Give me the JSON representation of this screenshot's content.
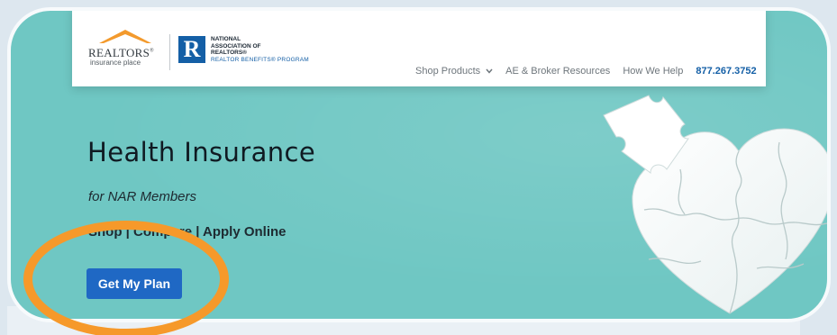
{
  "nav": {
    "logo_word": "REALTORS",
    "logo_reg": "®",
    "logo_sub": "insurance place",
    "nar_mark": "R",
    "nar_line1": "NATIONAL",
    "nar_line2": "ASSOCIATION OF",
    "nar_line3": "REALTORS®",
    "nar_line4": "REALTOR BENEFITS® PROGRAM",
    "items": [
      {
        "label": "Shop Products",
        "has_caret": true
      },
      {
        "label": "AE & Broker Resources"
      },
      {
        "label": "How We Help"
      }
    ],
    "phone": "877.267.3752"
  },
  "hero": {
    "title": "Health Insurance",
    "subtitle": "for NAR Members",
    "steps": "Shop | Compare | Apply Online",
    "cta_label": "Get My Plan"
  },
  "icons": {
    "caret": "chevron-down-icon",
    "roof": "house-roof-icon",
    "heart": "puzzle-heart-illustration"
  },
  "colors": {
    "hero_bg": "#6fc7c3",
    "brand_blue": "#145fa6",
    "cta_blue": "#1f68c4",
    "annotation_orange": "#f6992a"
  }
}
